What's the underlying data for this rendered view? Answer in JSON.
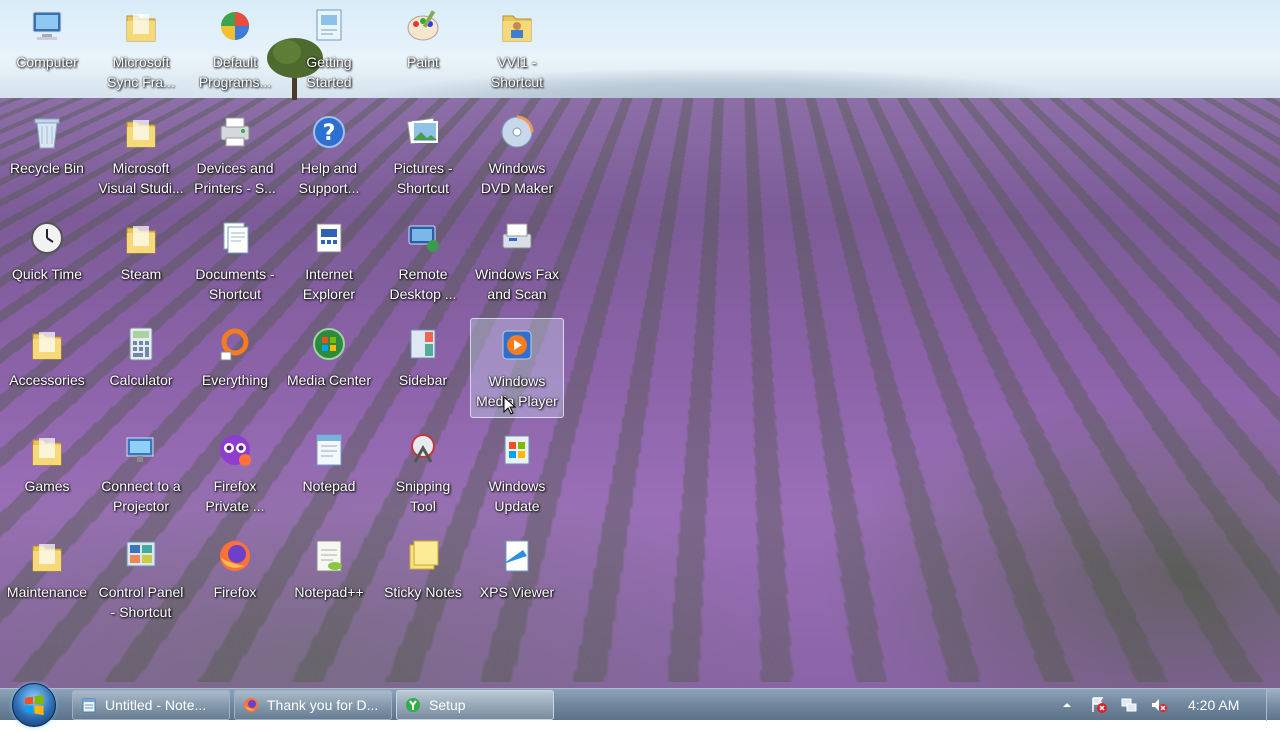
{
  "desktop": {
    "icons": [
      {
        "label": "Computer",
        "icon": "computer-icon"
      },
      {
        "label": "Microsoft\nSync Fra...",
        "icon": "folder-icon"
      },
      {
        "label": "Default\nPrograms...",
        "icon": "default-programs-icon"
      },
      {
        "label": "Getting\nStarted",
        "icon": "getting-started-icon"
      },
      {
        "label": "Paint",
        "icon": "paint-icon"
      },
      {
        "label": "VVI1 -\nShortcut",
        "icon": "folder-user-icon"
      },
      {
        "label": "Recycle Bin",
        "icon": "recycle-bin-icon"
      },
      {
        "label": "Microsoft\nVisual Studi...",
        "icon": "folder-icon"
      },
      {
        "label": "Devices and\nPrinters - S...",
        "icon": "devices-printers-icon"
      },
      {
        "label": "Help and\nSupport...",
        "icon": "help-icon"
      },
      {
        "label": "Pictures -\nShortcut",
        "icon": "pictures-icon"
      },
      {
        "label": "Windows\nDVD Maker",
        "icon": "dvd-maker-icon"
      },
      {
        "label": "Quick Time",
        "icon": "clock-icon"
      },
      {
        "label": "Steam",
        "icon": "folder-icon"
      },
      {
        "label": "Documents -\nShortcut",
        "icon": "documents-icon"
      },
      {
        "label": "Internet\nExplorer",
        "icon": "internet-explorer-icon"
      },
      {
        "label": "Remote\nDesktop ...",
        "icon": "remote-desktop-icon"
      },
      {
        "label": "Windows Fax\nand Scan",
        "icon": "fax-scan-icon"
      },
      {
        "label": "Accessories",
        "icon": "folder-icon"
      },
      {
        "label": "Calculator",
        "icon": "calculator-icon"
      },
      {
        "label": "Everything",
        "icon": "everything-icon"
      },
      {
        "label": "Media Center",
        "icon": "media-center-icon"
      },
      {
        "label": "Sidebar",
        "icon": "sidebar-icon"
      },
      {
        "label": "Windows\nMedia Player",
        "icon": "media-player-icon"
      },
      {
        "label": "Games",
        "icon": "folder-icon"
      },
      {
        "label": "Connect to a\nProjector",
        "icon": "projector-icon"
      },
      {
        "label": "Firefox\nPrivate ...",
        "icon": "firefox-private-icon"
      },
      {
        "label": "Notepad",
        "icon": "notepad-icon"
      },
      {
        "label": "Snipping\nTool",
        "icon": "snipping-tool-icon"
      },
      {
        "label": "Windows\nUpdate",
        "icon": "windows-update-icon"
      },
      {
        "label": "Maintenance",
        "icon": "folder-icon"
      },
      {
        "label": "Control Panel\n- Shortcut",
        "icon": "control-panel-icon"
      },
      {
        "label": "Firefox",
        "icon": "firefox-icon"
      },
      {
        "label": "Notepad++",
        "icon": "notepad-plus-icon"
      },
      {
        "label": "Sticky Notes",
        "icon": "sticky-notes-icon"
      },
      {
        "label": "XPS Viewer",
        "icon": "xps-viewer-icon"
      }
    ],
    "selected_icon": "Windows\nMedia Player"
  },
  "taskbar": {
    "start_icon": "windows-start-icon",
    "buttons": [
      {
        "label": "Untitled - Note...",
        "icon": "notepad-icon",
        "active": false
      },
      {
        "label": "Thank you for D...",
        "icon": "firefox-icon",
        "active": false
      },
      {
        "label": "Setup",
        "icon": "setup-icon",
        "active": true
      }
    ],
    "tray": {
      "icons": [
        "show-hidden-icons-icon",
        "action-center-icon",
        "network-icon",
        "volume-muted-icon"
      ],
      "clock": "4:20 AM"
    }
  },
  "colors": {
    "taskbar": "#6f879e",
    "label_text": "#ffffff",
    "field_lavender": "#8b62a8",
    "sky": "#d9ecf8"
  }
}
